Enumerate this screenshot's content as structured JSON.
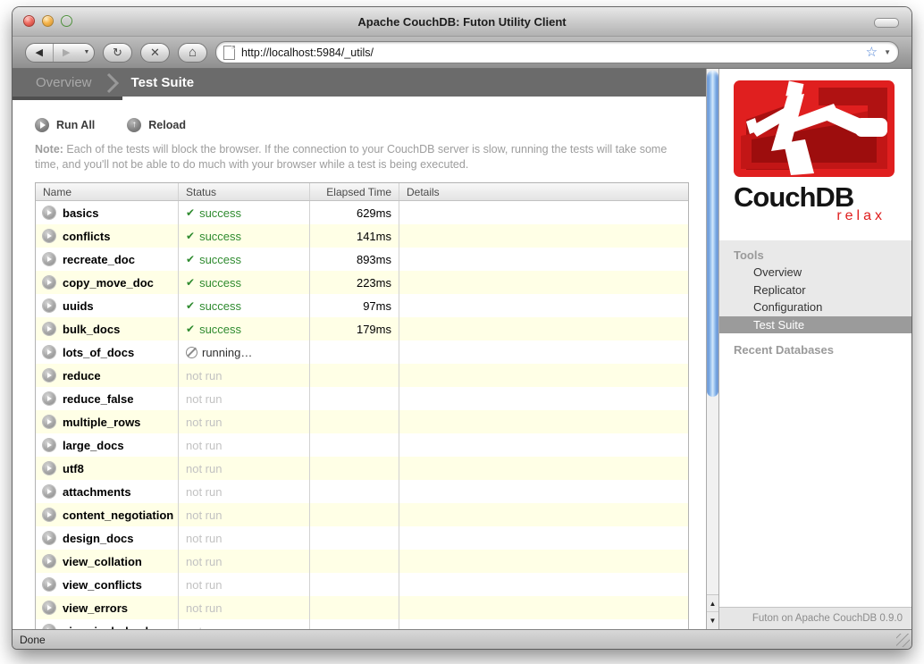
{
  "window": {
    "title": "Apache CouchDB: Futon Utility Client",
    "url": "http://localhost:5984/_utils/",
    "status_text": "Done"
  },
  "browser": {
    "icons": {
      "back": "◀",
      "forward": "▶",
      "nav_dropdown": "▼",
      "reload": "↻",
      "stop": "✕",
      "home": "⌂",
      "bookmark_star": "☆",
      "url_dropdown": "▼",
      "scroll_up": "▲",
      "scroll_down": "▼"
    }
  },
  "breadcrumb": {
    "parent": "Overview",
    "current": "Test Suite"
  },
  "actions": {
    "run_all": "Run All",
    "reload": "Reload"
  },
  "note": {
    "label": "Note:",
    "text": " Each of the tests will block the browser. If the connection to your CouchDB server is slow, running the tests will take some time, and you'll not be able to do much with your browser while a test is being executed."
  },
  "table": {
    "columns": [
      "Name",
      "Status",
      "Elapsed Time",
      "Details"
    ],
    "status_labels": {
      "success": "success",
      "running": "running…",
      "not_run": "not run"
    },
    "rows": [
      {
        "name": "basics",
        "status": "success",
        "elapsed": "629ms",
        "details": ""
      },
      {
        "name": "conflicts",
        "status": "success",
        "elapsed": "141ms",
        "details": ""
      },
      {
        "name": "recreate_doc",
        "status": "success",
        "elapsed": "893ms",
        "details": ""
      },
      {
        "name": "copy_move_doc",
        "status": "success",
        "elapsed": "223ms",
        "details": ""
      },
      {
        "name": "uuids",
        "status": "success",
        "elapsed": "97ms",
        "details": ""
      },
      {
        "name": "bulk_docs",
        "status": "success",
        "elapsed": "179ms",
        "details": ""
      },
      {
        "name": "lots_of_docs",
        "status": "running",
        "elapsed": "",
        "details": ""
      },
      {
        "name": "reduce",
        "status": "not_run",
        "elapsed": "",
        "details": ""
      },
      {
        "name": "reduce_false",
        "status": "not_run",
        "elapsed": "",
        "details": ""
      },
      {
        "name": "multiple_rows",
        "status": "not_run",
        "elapsed": "",
        "details": ""
      },
      {
        "name": "large_docs",
        "status": "not_run",
        "elapsed": "",
        "details": ""
      },
      {
        "name": "utf8",
        "status": "not_run",
        "elapsed": "",
        "details": ""
      },
      {
        "name": "attachments",
        "status": "not_run",
        "elapsed": "",
        "details": ""
      },
      {
        "name": "content_negotiation",
        "status": "not_run",
        "elapsed": "",
        "details": ""
      },
      {
        "name": "design_docs",
        "status": "not_run",
        "elapsed": "",
        "details": ""
      },
      {
        "name": "view_collation",
        "status": "not_run",
        "elapsed": "",
        "details": ""
      },
      {
        "name": "view_conflicts",
        "status": "not_run",
        "elapsed": "",
        "details": ""
      },
      {
        "name": "view_errors",
        "status": "not_run",
        "elapsed": "",
        "details": ""
      },
      {
        "name": "view_include_docs",
        "status": "not_run",
        "elapsed": "",
        "details": ""
      }
    ]
  },
  "sidebar": {
    "logo": {
      "title": "CouchDB",
      "tagline": "relax"
    },
    "tools": {
      "header": "Tools",
      "items": [
        {
          "label": "Overview",
          "selected": false
        },
        {
          "label": "Replicator",
          "selected": false
        },
        {
          "label": "Configuration",
          "selected": false
        },
        {
          "label": "Test Suite",
          "selected": true
        }
      ]
    },
    "recent_header": "Recent Databases",
    "footer": "Futon on Apache CouchDB 0.9.0"
  },
  "colors": {
    "accent_red": "#df1e1e",
    "success_green": "#2f8b2f",
    "row_alt_yellow": "#ffffe6",
    "selected_item_gray": "#9b9b9b",
    "breadcrumb_gray": "#6b6b6b"
  }
}
